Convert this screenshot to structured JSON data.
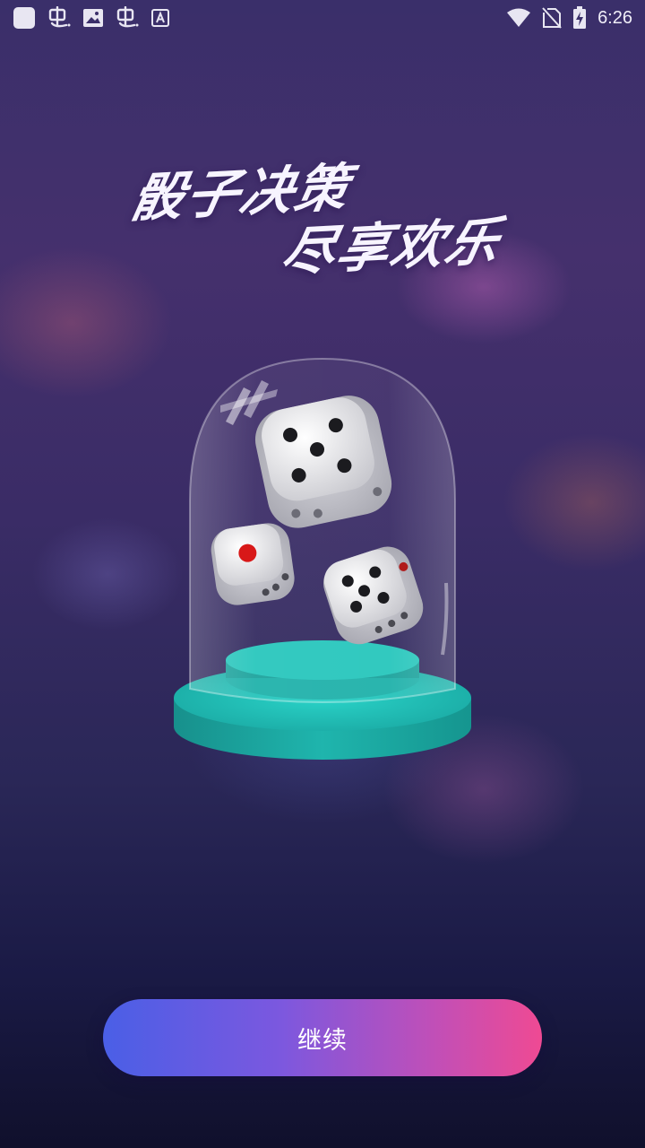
{
  "status_bar": {
    "left_icons": [
      "app-square-icon",
      "bug-icon",
      "image-icon",
      "bug-icon",
      "font-a-icon"
    ],
    "right_icons": [
      "wifi-icon",
      "no-sim-icon",
      "battery-charging-icon"
    ],
    "time": "6:26"
  },
  "headline": {
    "line1": "骰子决策",
    "line2": "尽享欢乐"
  },
  "illustration": {
    "description_icon": "dice-in-glass-dome-icon"
  },
  "continue_button": {
    "label": "继续"
  },
  "colors": {
    "button_gradient_start": "#4a5fe6",
    "button_gradient_end": "#ef4a93",
    "pedestal": "#1fb8b0",
    "background_top": "#3a2f6a",
    "background_bottom": "#10102c"
  }
}
